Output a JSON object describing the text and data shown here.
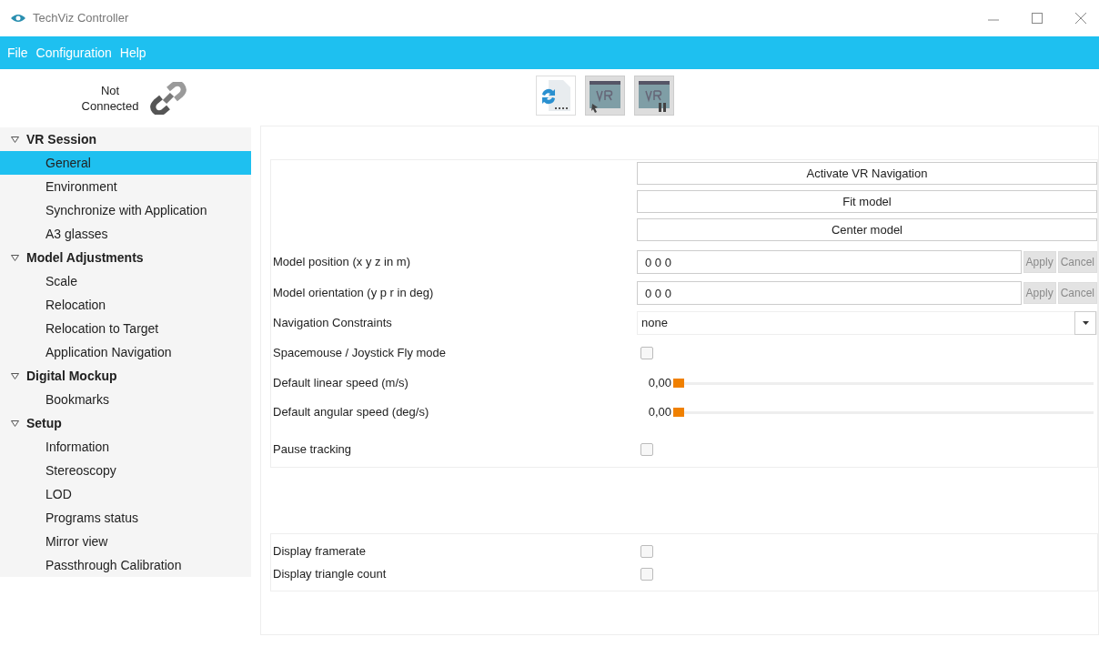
{
  "window": {
    "title": "TechViz Controller"
  },
  "menu": [
    "File",
    "Configuration",
    "Help"
  ],
  "connection": {
    "status": "Not Connected"
  },
  "sidebar": {
    "groups": [
      {
        "label": "VR Session",
        "expanded": true,
        "children": [
          {
            "label": "General",
            "selected": true
          },
          {
            "label": "Environment",
            "selected": false
          },
          {
            "label": "Synchronize with Application",
            "selected": false
          },
          {
            "label": "A3 glasses",
            "selected": false
          }
        ]
      },
      {
        "label": "Model Adjustments",
        "expanded": true,
        "children": [
          {
            "label": "Scale",
            "selected": false
          },
          {
            "label": "Relocation",
            "selected": false
          },
          {
            "label": "Relocation to Target",
            "selected": false
          },
          {
            "label": "Application Navigation",
            "selected": false
          }
        ]
      },
      {
        "label": "Digital Mockup",
        "expanded": true,
        "children": [
          {
            "label": "Bookmarks",
            "selected": false
          }
        ]
      },
      {
        "label": "Setup",
        "expanded": true,
        "children": [
          {
            "label": "Information",
            "selected": false
          },
          {
            "label": "Stereoscopy",
            "selected": false
          },
          {
            "label": "LOD",
            "selected": false
          },
          {
            "label": "Programs status",
            "selected": false
          },
          {
            "label": "Mirror view",
            "selected": false
          },
          {
            "label": "Passthrough Calibration",
            "selected": false
          }
        ]
      }
    ]
  },
  "toolbar": [
    {
      "kind": "sync",
      "disabled": false
    },
    {
      "kind": "vr-start",
      "disabled": true
    },
    {
      "kind": "vr-pause",
      "disabled": true
    }
  ],
  "actions": [
    "Activate VR Navigation",
    "Fit model",
    "Center model"
  ],
  "settings": [
    {
      "kind": "field",
      "label": "Model position (x y z in m)",
      "value": "0 0 0",
      "buttons": [
        {
          "label": "Apply",
          "disabled": true
        },
        {
          "label": "Cancel",
          "disabled": true
        }
      ]
    },
    {
      "kind": "field",
      "label": "Model orientation (y p r in deg)",
      "value": "0 0 0",
      "buttons": [
        {
          "label": "Apply",
          "disabled": true
        },
        {
          "label": "Cancel",
          "disabled": true
        }
      ]
    },
    {
      "kind": "dropdown",
      "label": "Navigation Constraints",
      "value": "none"
    },
    {
      "kind": "checkbox",
      "label": "Spacemouse / Joystick Fly mode",
      "checked": false
    },
    {
      "kind": "slider",
      "label": "Default linear speed (m/s)",
      "reading": "0,00",
      "level": 0
    },
    {
      "kind": "slider",
      "label": "Default angular speed (deg/s)",
      "reading": "0,00",
      "level": 0
    },
    {
      "kind": "checkbox",
      "label": "Pause tracking",
      "checked": false
    }
  ],
  "display": [
    {
      "kind": "checkbox",
      "label": "Display framerate",
      "checked": false
    },
    {
      "kind": "checkbox",
      "label": "Display triangle count",
      "checked": false
    }
  ]
}
